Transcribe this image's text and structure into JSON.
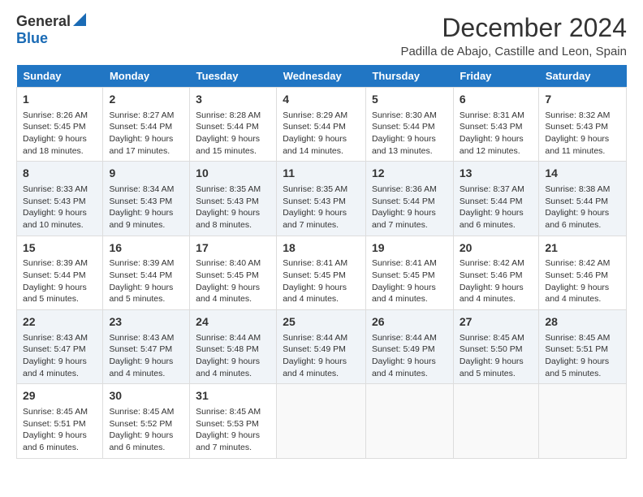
{
  "logo": {
    "general": "General",
    "blue": "Blue"
  },
  "title": "December 2024",
  "location": "Padilla de Abajo, Castille and Leon, Spain",
  "headers": [
    "Sunday",
    "Monday",
    "Tuesday",
    "Wednesday",
    "Thursday",
    "Friday",
    "Saturday"
  ],
  "weeks": [
    [
      {
        "day": "1",
        "info": "Sunrise: 8:26 AM\nSunset: 5:45 PM\nDaylight: 9 hours and 18 minutes."
      },
      {
        "day": "2",
        "info": "Sunrise: 8:27 AM\nSunset: 5:44 PM\nDaylight: 9 hours and 17 minutes."
      },
      {
        "day": "3",
        "info": "Sunrise: 8:28 AM\nSunset: 5:44 PM\nDaylight: 9 hours and 15 minutes."
      },
      {
        "day": "4",
        "info": "Sunrise: 8:29 AM\nSunset: 5:44 PM\nDaylight: 9 hours and 14 minutes."
      },
      {
        "day": "5",
        "info": "Sunrise: 8:30 AM\nSunset: 5:44 PM\nDaylight: 9 hours and 13 minutes."
      },
      {
        "day": "6",
        "info": "Sunrise: 8:31 AM\nSunset: 5:43 PM\nDaylight: 9 hours and 12 minutes."
      },
      {
        "day": "7",
        "info": "Sunrise: 8:32 AM\nSunset: 5:43 PM\nDaylight: 9 hours and 11 minutes."
      }
    ],
    [
      {
        "day": "8",
        "info": "Sunrise: 8:33 AM\nSunset: 5:43 PM\nDaylight: 9 hours and 10 minutes."
      },
      {
        "day": "9",
        "info": "Sunrise: 8:34 AM\nSunset: 5:43 PM\nDaylight: 9 hours and 9 minutes."
      },
      {
        "day": "10",
        "info": "Sunrise: 8:35 AM\nSunset: 5:43 PM\nDaylight: 9 hours and 8 minutes."
      },
      {
        "day": "11",
        "info": "Sunrise: 8:35 AM\nSunset: 5:43 PM\nDaylight: 9 hours and 7 minutes."
      },
      {
        "day": "12",
        "info": "Sunrise: 8:36 AM\nSunset: 5:44 PM\nDaylight: 9 hours and 7 minutes."
      },
      {
        "day": "13",
        "info": "Sunrise: 8:37 AM\nSunset: 5:44 PM\nDaylight: 9 hours and 6 minutes."
      },
      {
        "day": "14",
        "info": "Sunrise: 8:38 AM\nSunset: 5:44 PM\nDaylight: 9 hours and 6 minutes."
      }
    ],
    [
      {
        "day": "15",
        "info": "Sunrise: 8:39 AM\nSunset: 5:44 PM\nDaylight: 9 hours and 5 minutes."
      },
      {
        "day": "16",
        "info": "Sunrise: 8:39 AM\nSunset: 5:44 PM\nDaylight: 9 hours and 5 minutes."
      },
      {
        "day": "17",
        "info": "Sunrise: 8:40 AM\nSunset: 5:45 PM\nDaylight: 9 hours and 4 minutes."
      },
      {
        "day": "18",
        "info": "Sunrise: 8:41 AM\nSunset: 5:45 PM\nDaylight: 9 hours and 4 minutes."
      },
      {
        "day": "19",
        "info": "Sunrise: 8:41 AM\nSunset: 5:45 PM\nDaylight: 9 hours and 4 minutes."
      },
      {
        "day": "20",
        "info": "Sunrise: 8:42 AM\nSunset: 5:46 PM\nDaylight: 9 hours and 4 minutes."
      },
      {
        "day": "21",
        "info": "Sunrise: 8:42 AM\nSunset: 5:46 PM\nDaylight: 9 hours and 4 minutes."
      }
    ],
    [
      {
        "day": "22",
        "info": "Sunrise: 8:43 AM\nSunset: 5:47 PM\nDaylight: 9 hours and 4 minutes."
      },
      {
        "day": "23",
        "info": "Sunrise: 8:43 AM\nSunset: 5:47 PM\nDaylight: 9 hours and 4 minutes."
      },
      {
        "day": "24",
        "info": "Sunrise: 8:44 AM\nSunset: 5:48 PM\nDaylight: 9 hours and 4 minutes."
      },
      {
        "day": "25",
        "info": "Sunrise: 8:44 AM\nSunset: 5:49 PM\nDaylight: 9 hours and 4 minutes."
      },
      {
        "day": "26",
        "info": "Sunrise: 8:44 AM\nSunset: 5:49 PM\nDaylight: 9 hours and 4 minutes."
      },
      {
        "day": "27",
        "info": "Sunrise: 8:45 AM\nSunset: 5:50 PM\nDaylight: 9 hours and 5 minutes."
      },
      {
        "day": "28",
        "info": "Sunrise: 8:45 AM\nSunset: 5:51 PM\nDaylight: 9 hours and 5 minutes."
      }
    ],
    [
      {
        "day": "29",
        "info": "Sunrise: 8:45 AM\nSunset: 5:51 PM\nDaylight: 9 hours and 6 minutes."
      },
      {
        "day": "30",
        "info": "Sunrise: 8:45 AM\nSunset: 5:52 PM\nDaylight: 9 hours and 6 minutes."
      },
      {
        "day": "31",
        "info": "Sunrise: 8:45 AM\nSunset: 5:53 PM\nDaylight: 9 hours and 7 minutes."
      },
      {
        "day": "",
        "info": ""
      },
      {
        "day": "",
        "info": ""
      },
      {
        "day": "",
        "info": ""
      },
      {
        "day": "",
        "info": ""
      }
    ]
  ]
}
